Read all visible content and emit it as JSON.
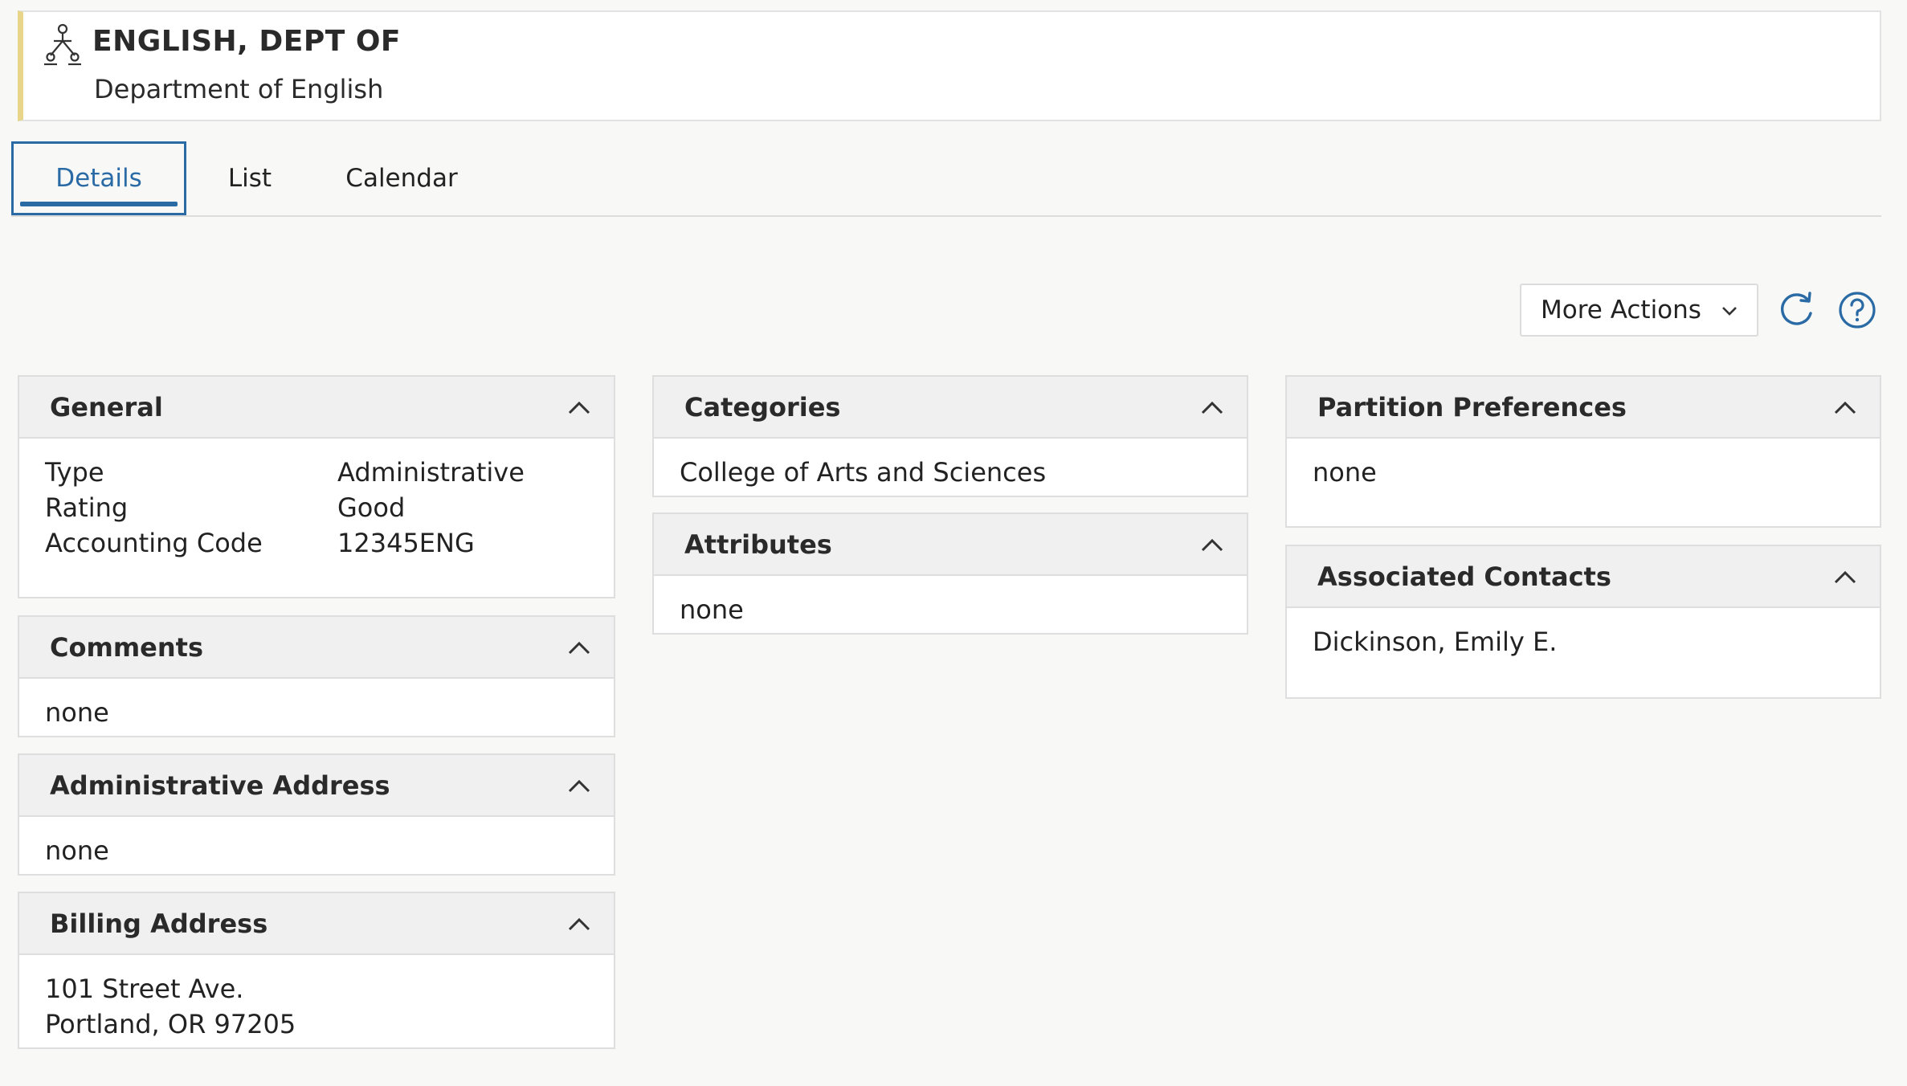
{
  "header": {
    "title": "ENGLISH, DEPT OF",
    "subtitle": "Department of English",
    "icon": "org-chart-icon",
    "accent_color": "#e8d58a"
  },
  "tabs": [
    {
      "label": "Details",
      "active": true
    },
    {
      "label": "List",
      "active": false
    },
    {
      "label": "Calendar",
      "active": false
    }
  ],
  "toolbar": {
    "more_actions_label": "More Actions",
    "refresh_icon": "refresh-icon",
    "help_icon": "help-icon",
    "accent_color": "#2a6aa5"
  },
  "panels": {
    "general": {
      "title": "General",
      "rows": [
        {
          "label": "Type",
          "value": "Administrative"
        },
        {
          "label": "Rating",
          "value": "Good"
        },
        {
          "label": "Accounting Code",
          "value": "12345ENG"
        }
      ]
    },
    "comments": {
      "title": "Comments",
      "value": "none"
    },
    "admin_address": {
      "title": "Administrative Address",
      "value": "none"
    },
    "billing_address": {
      "title": "Billing Address",
      "line1": "101 Street Ave.",
      "line2": "Portland, OR 97205"
    },
    "categories": {
      "title": "Categories",
      "value": "College of Arts and Sciences"
    },
    "attributes": {
      "title": "Attributes",
      "value": "none"
    },
    "partition_preferences": {
      "title": "Partition Preferences",
      "value": "none"
    },
    "associated_contacts": {
      "title": "Associated Contacts",
      "value": "Dickinson, Emily E."
    }
  }
}
